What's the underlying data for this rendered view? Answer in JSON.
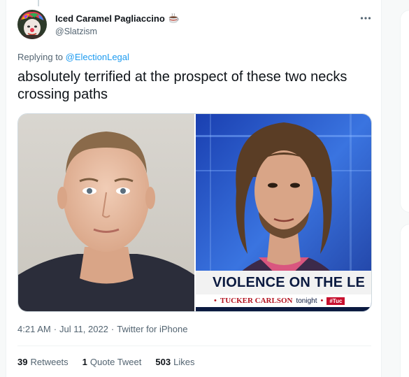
{
  "tweet": {
    "author": {
      "display_name": "Iced Caramel Pagliaccino",
      "name_emoji": "coffee-emoji-icon",
      "handle": "@Slatzism",
      "avatar_icon": "clown-avatar"
    },
    "more_icon": "more-dots-icon",
    "replying_to_prefix": "Replying to ",
    "replying_to_handle": "@ElectionLegal",
    "text": "absolutely terrified at the prospect of these two necks crossing paths",
    "media": {
      "left_image": "mugshot-photo",
      "right_image": "tv-interview-photo",
      "chyron_headline": "VIOLENCE ON THE LE",
      "chyron_show": "TUCKER CARLSON",
      "chyron_tonight": "tonight",
      "chyron_tag": "#Tuc"
    },
    "time": "4:21 AM",
    "date": "Jul 11, 2022",
    "separator": "·",
    "source": "Twitter for iPhone",
    "stats": {
      "retweets_count": "39",
      "retweets_label": "Retweets",
      "quotes_count": "1",
      "quotes_label": "Quote Tweet",
      "likes_count": "503",
      "likes_label": "Likes"
    }
  },
  "colors": {
    "link": "#1d9bf0",
    "secondary_text": "#536471",
    "primary_text": "#0f1419",
    "chyron_navy": "#0b1a40",
    "chyron_red": "#c8102e"
  }
}
